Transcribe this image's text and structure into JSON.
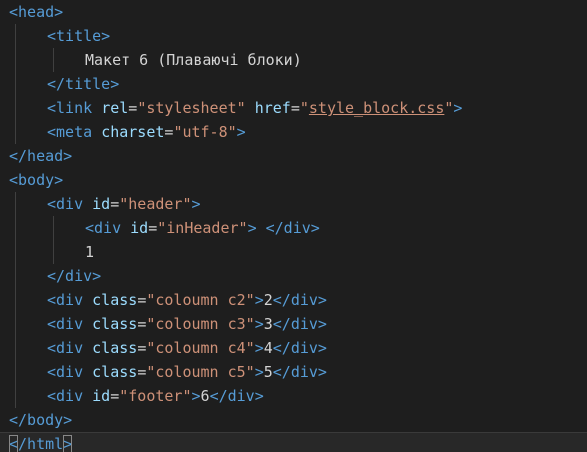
{
  "editor": {
    "language": "html",
    "colors": {
      "background": "#1e1e1e",
      "tag": "#569cd6",
      "attribute": "#9cdcfe",
      "string": "#ce9178",
      "text": "#d4d4d4"
    },
    "lines": [
      {
        "indent": 0,
        "tokens": [
          [
            "t",
            "<head>"
          ]
        ]
      },
      {
        "indent": 1,
        "tokens": [
          [
            "t",
            "<title>"
          ]
        ]
      },
      {
        "indent": 2,
        "tokens": [
          [
            "x",
            "Макет 6 (Плаваючі блоки)"
          ]
        ]
      },
      {
        "indent": 1,
        "tokens": [
          [
            "t",
            "</title>"
          ]
        ]
      },
      {
        "indent": 1,
        "tokens": [
          [
            "t",
            "<link"
          ],
          [
            "x",
            " "
          ],
          [
            "a",
            "rel"
          ],
          [
            "x",
            "="
          ],
          [
            "s",
            "\"stylesheet\""
          ],
          [
            "x",
            " "
          ],
          [
            "a",
            "href"
          ],
          [
            "x",
            "="
          ],
          [
            "s",
            "\""
          ],
          [
            "sl",
            "style_block.css"
          ],
          [
            "s",
            "\""
          ],
          [
            "t",
            ">"
          ]
        ]
      },
      {
        "indent": 1,
        "tokens": [
          [
            "t",
            "<meta"
          ],
          [
            "x",
            " "
          ],
          [
            "a",
            "charset"
          ],
          [
            "x",
            "="
          ],
          [
            "s",
            "\"utf-8\""
          ],
          [
            "t",
            ">"
          ]
        ]
      },
      {
        "indent": 0,
        "tokens": [
          [
            "t",
            "</head>"
          ]
        ]
      },
      {
        "indent": 0,
        "tokens": [
          [
            "t",
            "<body>"
          ]
        ]
      },
      {
        "indent": 1,
        "tokens": [
          [
            "t",
            "<div"
          ],
          [
            "x",
            " "
          ],
          [
            "a",
            "id"
          ],
          [
            "x",
            "="
          ],
          [
            "s",
            "\"header\""
          ],
          [
            "t",
            ">"
          ]
        ]
      },
      {
        "indent": 2,
        "tokens": [
          [
            "t",
            "<div"
          ],
          [
            "x",
            " "
          ],
          [
            "a",
            "id"
          ],
          [
            "x",
            "="
          ],
          [
            "s",
            "\"inHeader\""
          ],
          [
            "t",
            ">"
          ],
          [
            "x",
            " "
          ],
          [
            "t",
            "</div>"
          ]
        ]
      },
      {
        "indent": 2,
        "tokens": [
          [
            "x",
            "1"
          ]
        ]
      },
      {
        "indent": 1,
        "tokens": [
          [
            "t",
            "</div>"
          ]
        ]
      },
      {
        "indent": 1,
        "tokens": [
          [
            "t",
            "<div"
          ],
          [
            "x",
            " "
          ],
          [
            "a",
            "class"
          ],
          [
            "x",
            "="
          ],
          [
            "s",
            "\"coloumn c2\""
          ],
          [
            "t",
            ">"
          ],
          [
            "x",
            "2"
          ],
          [
            "t",
            "</div>"
          ]
        ]
      },
      {
        "indent": 1,
        "tokens": [
          [
            "t",
            "<div"
          ],
          [
            "x",
            " "
          ],
          [
            "a",
            "class"
          ],
          [
            "x",
            "="
          ],
          [
            "s",
            "\"coloumn c3\""
          ],
          [
            "t",
            ">"
          ],
          [
            "x",
            "3"
          ],
          [
            "t",
            "</div>"
          ]
        ]
      },
      {
        "indent": 1,
        "tokens": [
          [
            "t",
            "<div"
          ],
          [
            "x",
            " "
          ],
          [
            "a",
            "class"
          ],
          [
            "x",
            "="
          ],
          [
            "s",
            "\"coloumn c4\""
          ],
          [
            "t",
            ">"
          ],
          [
            "x",
            "4"
          ],
          [
            "t",
            "</div>"
          ]
        ]
      },
      {
        "indent": 1,
        "tokens": [
          [
            "t",
            "<div"
          ],
          [
            "x",
            " "
          ],
          [
            "a",
            "class"
          ],
          [
            "x",
            "="
          ],
          [
            "s",
            "\"coloumn c5\""
          ],
          [
            "t",
            ">"
          ],
          [
            "x",
            "5"
          ],
          [
            "t",
            "</div>"
          ]
        ]
      },
      {
        "indent": 1,
        "tokens": [
          [
            "t",
            "<div"
          ],
          [
            "x",
            " "
          ],
          [
            "a",
            "id"
          ],
          [
            "x",
            "="
          ],
          [
            "s",
            "\"footer\""
          ],
          [
            "t",
            ">"
          ],
          [
            "x",
            "6"
          ],
          [
            "t",
            "</div>"
          ]
        ]
      },
      {
        "indent": 0,
        "tokens": [
          [
            "t",
            "</body>"
          ]
        ]
      },
      {
        "indent": 0,
        "current": true,
        "tokens": [
          [
            "tm",
            "<"
          ],
          [
            "t",
            "/html"
          ],
          [
            "tm",
            ">"
          ]
        ]
      }
    ]
  }
}
